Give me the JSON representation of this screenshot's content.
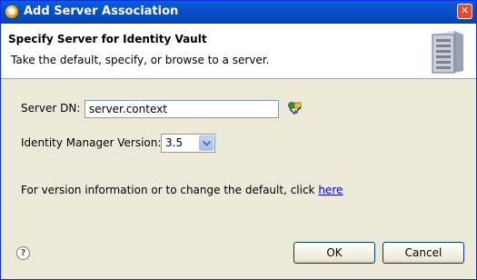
{
  "window": {
    "title": "Add Server Association"
  },
  "banner": {
    "title": "Specify Server for Identity Vault",
    "description": "Take the default, specify, or browse to a server."
  },
  "form": {
    "server_dn_label": "Server DN:",
    "server_dn_value": "server.context",
    "version_label": "Identity Manager Version:",
    "version_value": "3.5",
    "info_text": "For version information or to change the default, click ",
    "info_link": "here"
  },
  "buttons": {
    "ok": "OK",
    "cancel": "Cancel"
  },
  "icons": {
    "title": "app-icon",
    "close": "close-icon",
    "banner": "server-icon",
    "browse": "browse-icon",
    "dropdown": "chevron-down-icon",
    "help": "help-icon"
  }
}
